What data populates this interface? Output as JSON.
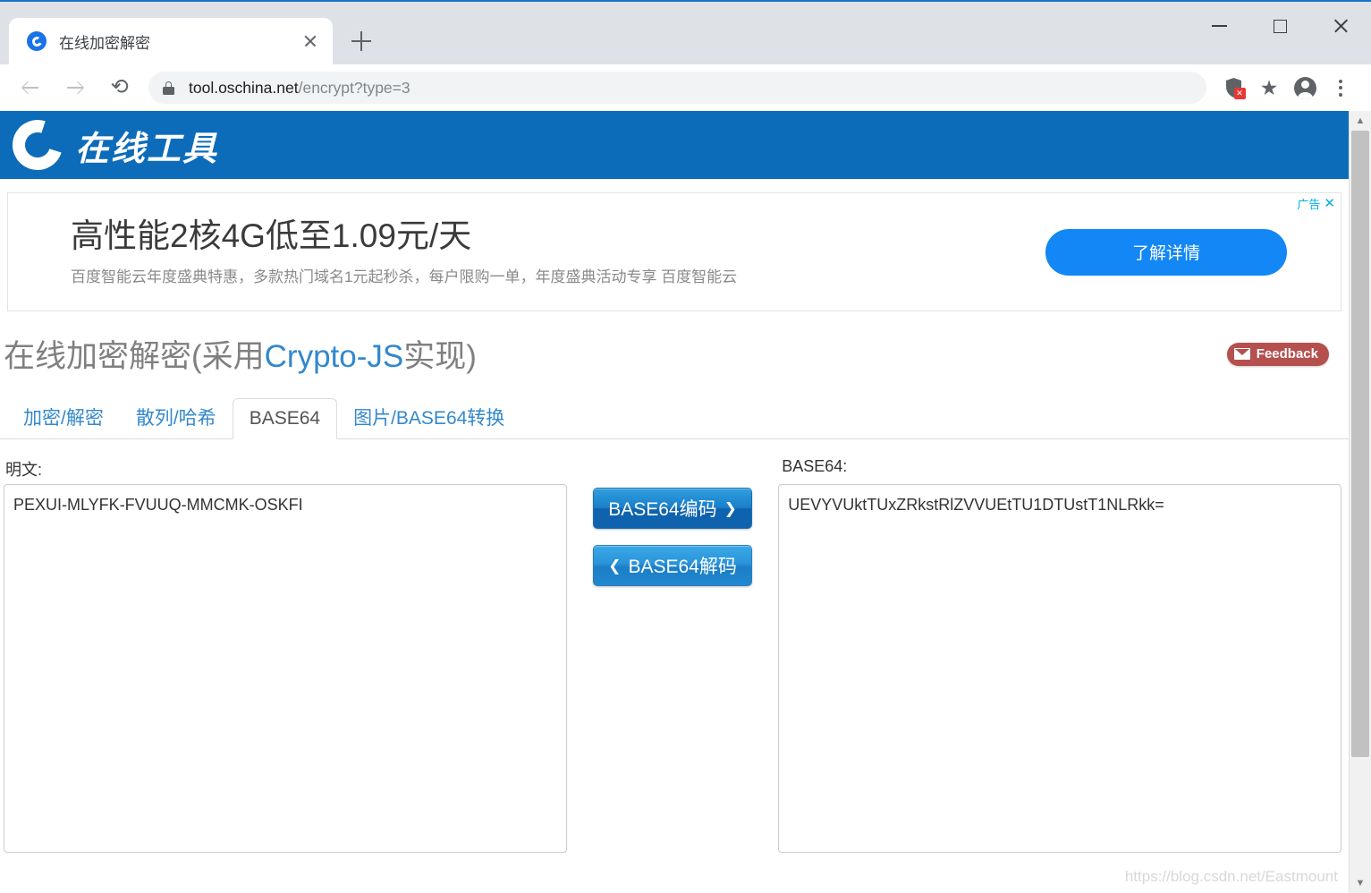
{
  "browser": {
    "tab": {
      "title": "在线加密解密",
      "favicon": "oschina-c-icon",
      "close": "×"
    },
    "newtab_label": "+",
    "window_controls": {
      "minimize": "—",
      "maximize": "□",
      "close": "✕"
    },
    "nav": {
      "back": "←",
      "forward": "→",
      "reload": "⟳"
    },
    "omnibox": {
      "lock": "secure-lock-icon",
      "host": "tool.oschina.net",
      "path": "/encrypt?type=3"
    },
    "toolbar_icons": {
      "blocked_content": "shield-blocked-icon",
      "blocked_badge": "✕",
      "bookmark": "★",
      "profile": "profile-avatar-icon",
      "menu": "three-dot-menu-icon"
    }
  },
  "site": {
    "logo_text": "在线工具",
    "header_color": "#0d6cb9"
  },
  "ad": {
    "tag_label": "广告",
    "close_label": "✕",
    "title": "高性能2核4G低至1.09元/天",
    "subtitle": "百度智能云年度盛典特惠，多款热门域名1元起秒杀，每户限购一单，年度盛典活动专享 百度智能云",
    "cta_label": "了解详情",
    "cta_color": "#1287f5"
  },
  "page": {
    "title_prefix": "在线加密解密(采用",
    "title_link": "Crypto-JS",
    "title_suffix": "实现)",
    "feedback_label": "Feedback",
    "feedback_color": "#b5504e"
  },
  "tabs": [
    {
      "label": "加密/解密",
      "active": false
    },
    {
      "label": "散列/哈希",
      "active": false
    },
    {
      "label": "BASE64",
      "active": true
    },
    {
      "label": "图片/BASE64转换",
      "active": false
    }
  ],
  "form": {
    "plain_label": "明文:",
    "plain_value": "PEXUI-MLYFK-FVUUQ-MMCMK-OSKFI",
    "base64_label": "BASE64:",
    "base64_value": "UEVYVUktTUxZRkstRlZVVUEtTU1DTUstT1NLRkk=",
    "encode_button": "BASE64编码",
    "encode_chevron": "❯",
    "decode_button": "BASE64解码",
    "decode_chevron": "❮"
  },
  "watermark": "https://blog.csdn.net/Eastmount",
  "scrollbar": {
    "up_arrow": "▲",
    "down_arrow": "▼"
  }
}
